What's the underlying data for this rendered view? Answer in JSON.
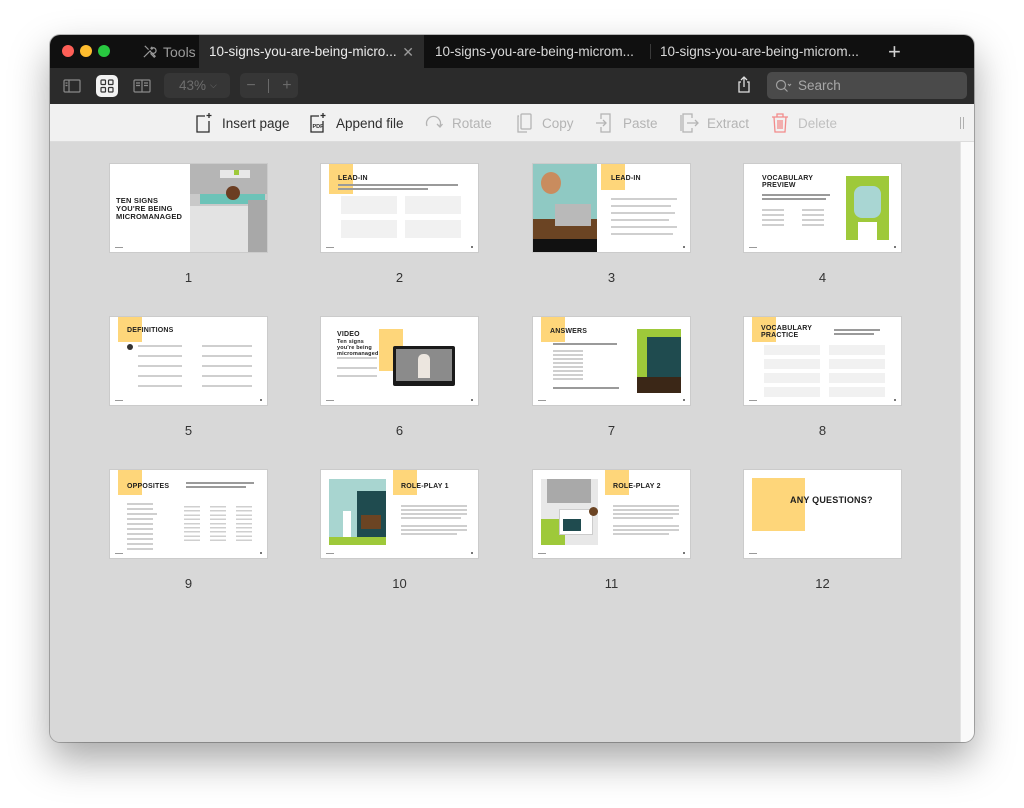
{
  "window": {
    "tools_tab_label": "Tools",
    "tabs": [
      {
        "label": "10-signs-you-are-being-micro...",
        "active": true,
        "closable": true
      },
      {
        "label": "10-signs-you-are-being-microm...",
        "active": false
      },
      {
        "label": "10-signs-you-are-being-microm...",
        "active": false
      }
    ],
    "new_tab_label": "+"
  },
  "toolbar": {
    "view_modes": [
      "sidebar-view",
      "grid-view",
      "two-page-view"
    ],
    "active_view": "grid-view",
    "zoom_level": "43%",
    "zoom_out_label": "−",
    "zoom_in_label": "+",
    "search_placeholder": "Search"
  },
  "actions": [
    {
      "label": "Insert page",
      "icon": "insert-page-icon",
      "enabled": true
    },
    {
      "label": "Append file",
      "icon": "pdf-append-icon",
      "enabled": true
    },
    {
      "label": "Rotate",
      "icon": "rotate-icon",
      "enabled": false
    },
    {
      "label": "Copy",
      "icon": "copy-icon",
      "enabled": false
    },
    {
      "label": "Paste",
      "icon": "paste-icon",
      "enabled": false
    },
    {
      "label": "Extract",
      "icon": "extract-icon",
      "enabled": false
    },
    {
      "label": "Delete",
      "icon": "trash-icon",
      "enabled": false
    }
  ],
  "colors": {
    "accent_yellow": "#fed67a",
    "delete_red": "#f28b8b",
    "slide_green": "#9ec93a",
    "slide_teal": "#1f4b4f"
  },
  "pages": [
    {
      "number": "1",
      "title": "TEN SIGNS YOU'RE BEING MICROMANAGED"
    },
    {
      "number": "2",
      "title": "LEAD-IN"
    },
    {
      "number": "3",
      "title": "LEAD-IN"
    },
    {
      "number": "4",
      "title": "VOCABULARY PREVIEW"
    },
    {
      "number": "5",
      "title": "DEFINITIONS"
    },
    {
      "number": "6",
      "title": "VIDEO",
      "subtitle": "Ten signs you're being micromanaged"
    },
    {
      "number": "7",
      "title": "ANSWERS"
    },
    {
      "number": "8",
      "title": "VOCABULARY PRACTICE"
    },
    {
      "number": "9",
      "title": "OPPOSITES"
    },
    {
      "number": "10",
      "title": "ROLE-PLAY 1"
    },
    {
      "number": "11",
      "title": "ROLE-PLAY 2"
    },
    {
      "number": "12",
      "title": "ANY QUESTIONS?"
    }
  ]
}
